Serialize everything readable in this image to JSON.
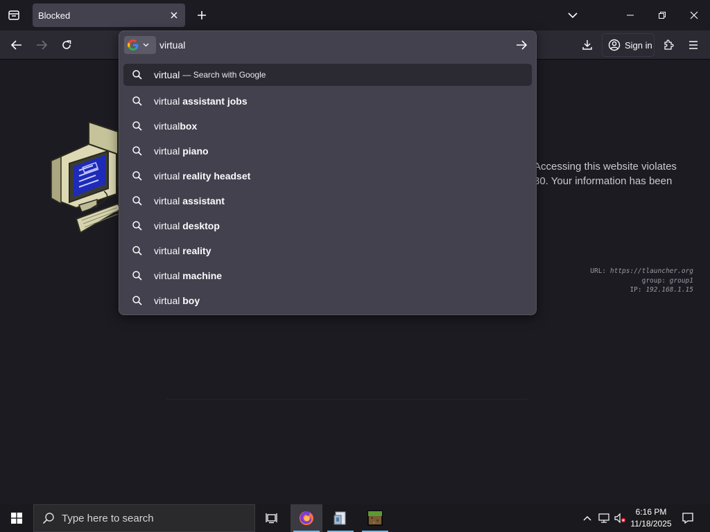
{
  "browser": {
    "tab": {
      "title": "Blocked"
    },
    "toolbar": {
      "sign_in_label": "Sign in"
    }
  },
  "urlbar": {
    "value": "virtual ",
    "search_engine_icon": "google-icon",
    "suggestions": [
      {
        "prefix": "virtual",
        "bold": "",
        "action": "— Search with Google",
        "selected": true
      },
      {
        "prefix": "virtual ",
        "bold": "assistant jobs"
      },
      {
        "prefix": "virtual",
        "bold": "box"
      },
      {
        "prefix": "virtual ",
        "bold": "piano"
      },
      {
        "prefix": "virtual ",
        "bold": "reality headset"
      },
      {
        "prefix": "virtual ",
        "bold": "assistant"
      },
      {
        "prefix": "virtual ",
        "bold": "desktop"
      },
      {
        "prefix": "virtual ",
        "bold": "reality"
      },
      {
        "prefix": "virtual ",
        "bold": "machine"
      },
      {
        "prefix": "virtual ",
        "bold": "boy"
      }
    ]
  },
  "page": {
    "message_line1": "Accessing this website violates",
    "message_line2": "30. Your information has been",
    "info": {
      "url_label": "URL:",
      "url_value": "https://tlauncher.org",
      "group_label": "group:",
      "group_value": "group1",
      "ip_label": "IP:",
      "ip_value": "192.168.1.15"
    }
  },
  "taskbar": {
    "search_placeholder": "Type here to search",
    "time": "6:16 PM",
    "date": "11/18/2025"
  }
}
